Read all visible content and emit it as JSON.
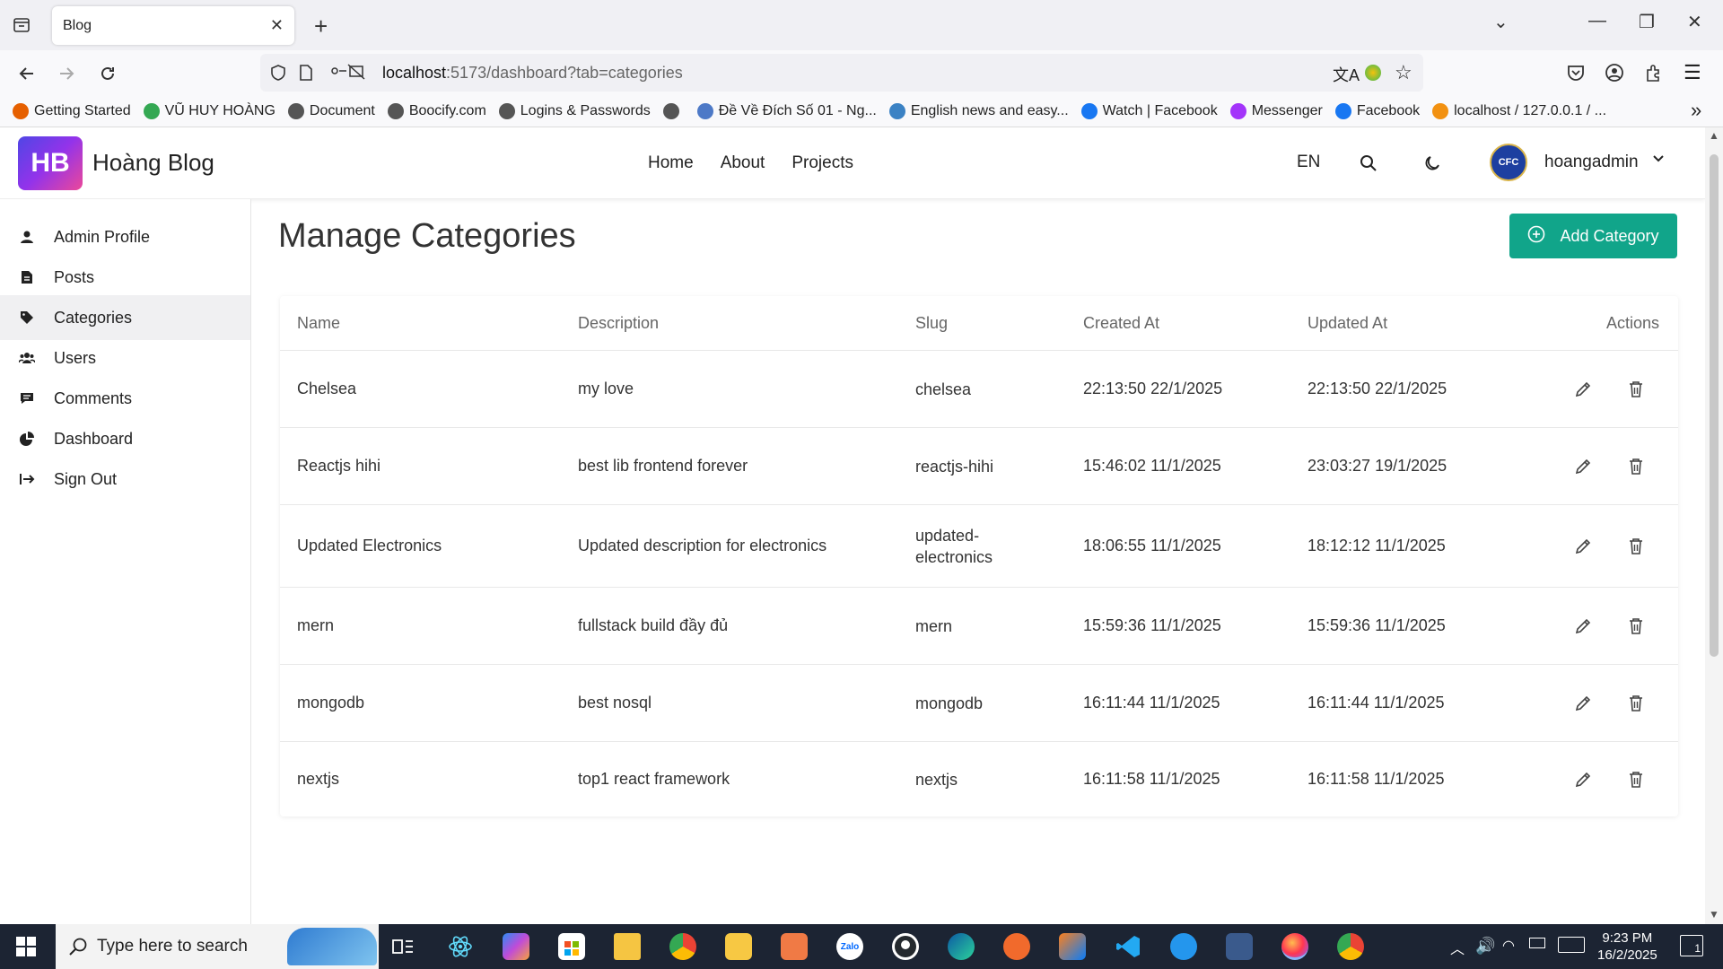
{
  "browser": {
    "tab_title": "Blog",
    "url_host": "localhost",
    "url_rest": ":5173/dashboard?tab=categories",
    "bookmarks": [
      {
        "label": "Getting Started",
        "color": "#e66000"
      },
      {
        "label": "VŨ HUY HOÀNG",
        "color": "#34a853"
      },
      {
        "label": "Document",
        "color": "#555555"
      },
      {
        "label": "Boocify.com",
        "color": "#555555"
      },
      {
        "label": "Logins & Passwords",
        "color": "#555555"
      },
      {
        "label": "",
        "color": "#555555"
      },
      {
        "label": "Đề Về Đích Số 01 - Ng...",
        "color": "#4d79c7"
      },
      {
        "label": "English news and easy...",
        "color": "#3b82c4"
      },
      {
        "label": "Watch | Facebook",
        "color": "#1877f2"
      },
      {
        "label": "Messenger",
        "color": "#a334fa"
      },
      {
        "label": "Facebook",
        "color": "#1877f2"
      },
      {
        "label": "localhost / 127.0.0.1 / ...",
        "color": "#f29111"
      }
    ]
  },
  "header": {
    "logo_badge": "HB",
    "logo_text": "Hoàng Blog",
    "nav": [
      "Home",
      "About",
      "Projects"
    ],
    "language": "EN",
    "username": "hoangadmin"
  },
  "sidebar": {
    "items": [
      {
        "label": "Admin Profile",
        "icon": "user-icon",
        "active": false
      },
      {
        "label": "Posts",
        "icon": "document-icon",
        "active": false
      },
      {
        "label": "Categories",
        "icon": "tag-icon",
        "active": true
      },
      {
        "label": "Users",
        "icon": "users-icon",
        "active": false
      },
      {
        "label": "Comments",
        "icon": "comment-icon",
        "active": false
      },
      {
        "label": "Dashboard",
        "icon": "pie-chart-icon",
        "active": false
      },
      {
        "label": "Sign Out",
        "icon": "sign-out-icon",
        "active": false
      }
    ]
  },
  "main": {
    "title": "Manage Categories",
    "add_button": "Add Category",
    "accent": "#11a58a",
    "columns": [
      "Name",
      "Description",
      "Slug",
      "Created At",
      "Updated At",
      "Actions"
    ],
    "rows": [
      {
        "name": "Chelsea",
        "description": "my love",
        "slug": "chelsea",
        "created": "22:13:50 22/1/2025",
        "updated": "22:13:50 22/1/2025"
      },
      {
        "name": "Reactjs hihi",
        "description": "best lib frontend forever",
        "slug": "reactjs-hihi",
        "created": "15:46:02 11/1/2025",
        "updated": "23:03:27 19/1/2025"
      },
      {
        "name": "Updated Electronics",
        "description": "Updated description for electronics",
        "slug": "updated-electronics",
        "created": "18:06:55 11/1/2025",
        "updated": "18:12:12 11/1/2025"
      },
      {
        "name": "mern",
        "description": "fullstack build đầy đủ",
        "slug": "mern",
        "created": "15:59:36 11/1/2025",
        "updated": "15:59:36 11/1/2025"
      },
      {
        "name": "mongodb",
        "description": "best nosql",
        "slug": "mongodb",
        "created": "16:11:44 11/1/2025",
        "updated": "16:11:44 11/1/2025"
      },
      {
        "name": "nextjs",
        "description": "top1 react framework",
        "slug": "nextjs",
        "created": "16:11:58 11/1/2025",
        "updated": "16:11:58 11/1/2025"
      }
    ]
  },
  "taskbar": {
    "search_placeholder": "Type here to search",
    "time": "9:23 PM",
    "date": "16/2/2025",
    "notification_count": "1"
  }
}
